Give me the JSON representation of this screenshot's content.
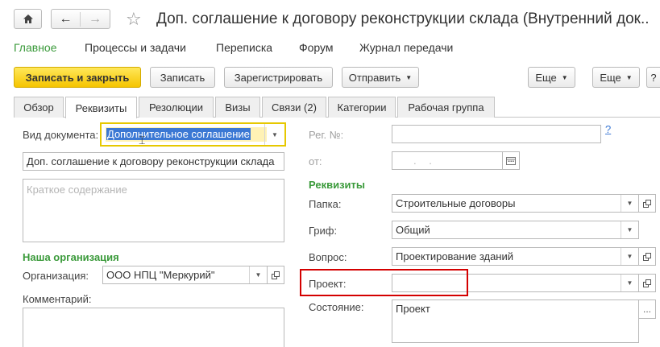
{
  "header": {
    "title": "Доп. соглашение к договору реконструкции склада (Внутренний док..."
  },
  "menu": {
    "items": [
      "Главное",
      "Процессы и задачи",
      "Переписка",
      "Форум",
      "Журнал передачи"
    ]
  },
  "toolbar": {
    "save_close": "Записать и закрыть",
    "save": "Записать",
    "register": "Зарегистрировать",
    "send": "Отправить",
    "more1": "Еще",
    "more2": "Еще",
    "help": "?"
  },
  "tabs": [
    "Обзор",
    "Реквизиты",
    "Резолюции",
    "Визы",
    "Связи (2)",
    "Категории",
    "Рабочая группа"
  ],
  "left": {
    "doc_type_label": "Вид документа:",
    "doc_type_value": "Дополнительное соглашение",
    "name_value": "Доп. соглашение к договору реконструкции склада",
    "summary_placeholder": "Краткое содержание",
    "org_section": "Наша организация",
    "org_label": "Организация:",
    "org_value": "ООО НПЦ \"Меркурий\"",
    "comment_label": "Комментарий:"
  },
  "right": {
    "reg_label": "Рег. №:",
    "reg_help": "?",
    "from_label": "от:",
    "date_placeholder": ".   .",
    "req_section": "Реквизиты",
    "folder_label": "Папка:",
    "folder_value": "Строительные договоры",
    "grif_label": "Гриф:",
    "grif_value": "Общий",
    "question_label": "Вопрос:",
    "question_value": "Проектирование зданий",
    "project_label": "Проект:",
    "project_value": "",
    "state_label": "Состояние:",
    "state_value": "Проект"
  },
  "colors": {
    "accent_green": "#3a9a3a",
    "primary_yellow": "#f5c400",
    "highlight_red": "#d40000",
    "selection_blue": "#3b78d4"
  }
}
